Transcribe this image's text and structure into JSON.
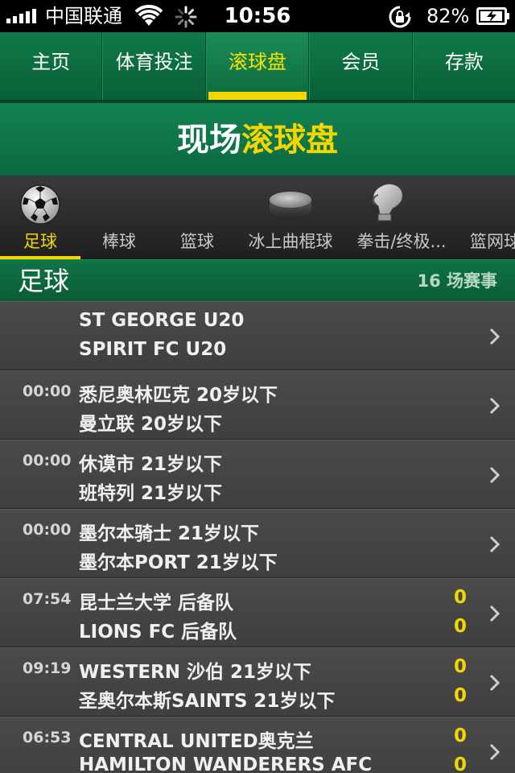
{
  "status_bar": {
    "carrier": "中国联通",
    "time": "10:56",
    "battery": "82%"
  },
  "top_nav": {
    "tabs": [
      {
        "label": "主页",
        "active": false
      },
      {
        "label": "体育投注",
        "active": false
      },
      {
        "label": "滚球盘",
        "active": true
      },
      {
        "label": "会员",
        "active": false
      },
      {
        "label": "存款",
        "active": false
      }
    ]
  },
  "page_title": {
    "prefix": "现场",
    "highlight": "滚球盘"
  },
  "sports": [
    {
      "label": "足球",
      "icon": "soccer-ball-icon",
      "active": true
    },
    {
      "label": "棒球",
      "icon": "",
      "active": false
    },
    {
      "label": "篮球",
      "icon": "",
      "active": false
    },
    {
      "label": "冰上曲棍球",
      "icon": "hockey-puck-icon",
      "active": false
    },
    {
      "label": "拳击/终极...",
      "icon": "boxing-glove-icon",
      "active": false
    },
    {
      "label": "篮网球",
      "icon": "",
      "active": false
    }
  ],
  "section": {
    "title": "足球",
    "count": "16 场赛事"
  },
  "matches": [
    {
      "time": "",
      "team1": "ST GEORGE U20",
      "team2": "SPIRIT FC U20",
      "score1": "",
      "score2": ""
    },
    {
      "time": "00:00",
      "team1": "悉尼奥林匹克 20岁以下",
      "team2": "曼立联 20岁以下",
      "score1": "",
      "score2": ""
    },
    {
      "time": "00:00",
      "team1": "休谟市 21岁以下",
      "team2": "班特列 21岁以下",
      "score1": "",
      "score2": ""
    },
    {
      "time": "00:00",
      "team1": "墨尔本骑士 21岁以下",
      "team2": "墨尔本PORT 21岁以下",
      "score1": "",
      "score2": ""
    },
    {
      "time": "07:54",
      "team1": "昆士兰大学 后备队",
      "team2": "LIONS FC 后备队",
      "score1": "0",
      "score2": "0"
    },
    {
      "time": "09:19",
      "team1": "WESTERN 沙伯 21岁以下",
      "team2": "圣奥尔本斯SAINTS 21岁以下",
      "score1": "0",
      "score2": "0"
    },
    {
      "time": "06:53",
      "team1": "CENTRAL UNITED奥克兰",
      "team2": "HAMILTON WANDERERS AFC",
      "score1": "0",
      "score2": "0"
    }
  ],
  "colors": {
    "accent": "#f3d600",
    "brand_green": "#0f7a49"
  }
}
